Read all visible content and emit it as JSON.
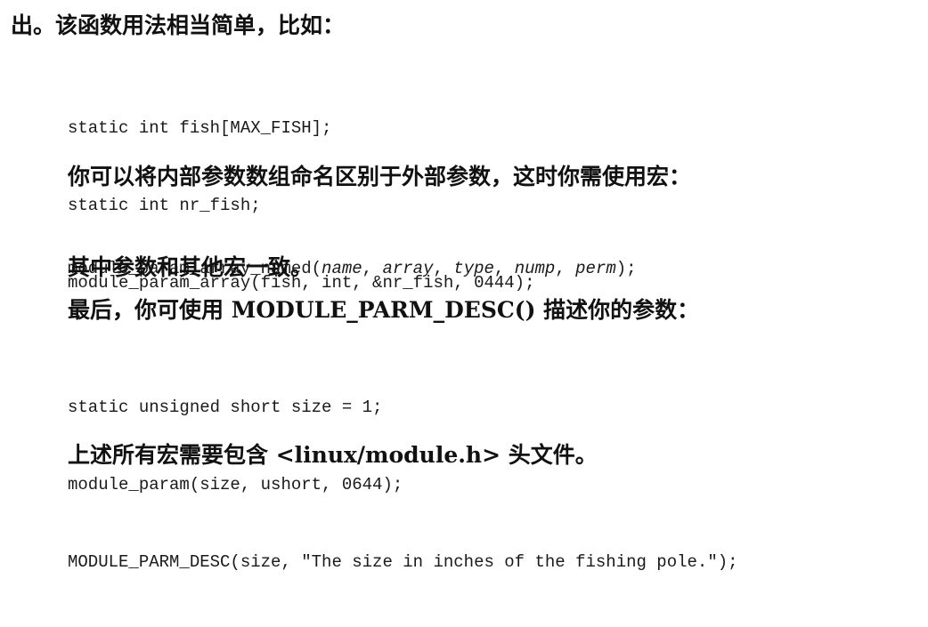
{
  "paragraphs": {
    "intro": "出。该函数用法相当简单，比如：",
    "rename_arrays": "你可以将内部参数数组命名区别于外部参数，这时你需使用宏：",
    "other_params": "其中参数和其他宏一致。",
    "describe_params": "最后，你可使用 MODULE_PARM_DESC() 描述你的参数：",
    "header_include": "上述所有宏需要包含 <linux/module.h> 头文件。"
  },
  "code": {
    "array_example": [
      "static int fish[MAX_FISH];",
      "static int nr_fish;",
      "module_param_array(fish, int, &nr_fish, 0444);"
    ],
    "named_macro": {
      "prefix": "module_param_array_named(",
      "name": "name",
      "sep1": ", ",
      "array": "array",
      "sep2": ", ",
      "type": "type",
      "sep3": ", ",
      "nump": "nump",
      "sep4": ", ",
      "perm": "perm",
      "suffix": ");"
    },
    "desc_example": [
      "static unsigned short size = 1;",
      "module_param(size, ushort, 0644);",
      "MODULE_PARM_DESC(size, \"The size in inches of the fishing pole.\");"
    ]
  }
}
